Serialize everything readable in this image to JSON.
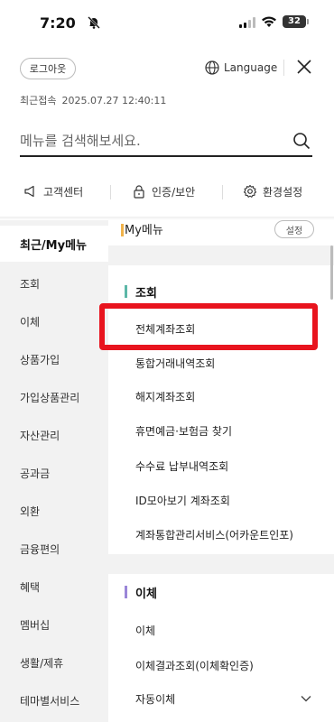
{
  "status": {
    "time": "7:20",
    "battery": "32"
  },
  "header": {
    "logout_label": "로그아웃",
    "language_label": "Language",
    "last_login_label": "최근접속",
    "last_login_time": "2025.07.27 12:40:11"
  },
  "search": {
    "placeholder": "메뉴를 검색해보세요."
  },
  "quick": {
    "customer_center": "고객센터",
    "security": "인증/보안",
    "settings": "환경설정"
  },
  "sidebar": {
    "items": [
      {
        "label": "최근/My메뉴"
      },
      {
        "label": "조회"
      },
      {
        "label": "이체"
      },
      {
        "label": "상품가입"
      },
      {
        "label": "가입상품관리"
      },
      {
        "label": "자산관리"
      },
      {
        "label": "공과금"
      },
      {
        "label": "외환"
      },
      {
        "label": "금융편의"
      },
      {
        "label": "혜택"
      },
      {
        "label": "멤버십"
      },
      {
        "label": "생활/제휴"
      },
      {
        "label": "테마별서비스"
      }
    ]
  },
  "content": {
    "my_menu_title": "My메뉴",
    "edit_label": "설정",
    "inquiry": {
      "title": "조회",
      "links": [
        "전체계좌조회",
        "통합거래내역조회",
        "해지계좌조회",
        "휴면예금·보험금 찾기",
        "수수료 납부내역조회",
        "ID모아보기 계좌조회",
        "계좌통합관리서비스(어카운트인포)"
      ]
    },
    "transfer": {
      "title": "이체",
      "links": [
        "이체",
        "이체결과조회(이체확인증)",
        "자동이체"
      ]
    }
  },
  "colors": {
    "highlight": "#e8141e",
    "inquiry_bar": "#5cb7a7",
    "transfer_bar": "#9a86d8",
    "mymenu_bar": "#f0b24a"
  }
}
